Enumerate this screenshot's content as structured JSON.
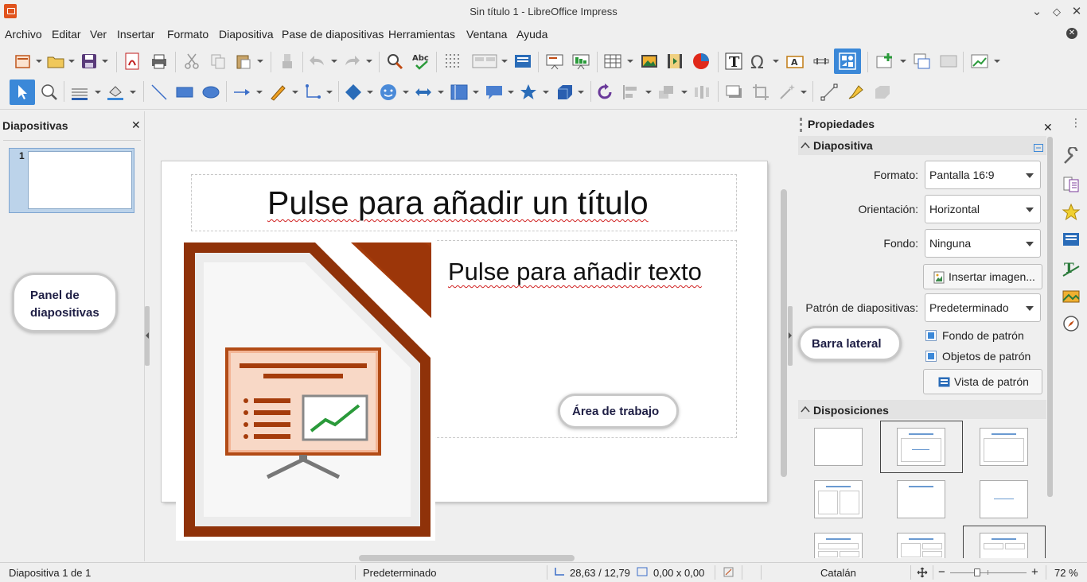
{
  "window": {
    "title": "Sin título 1 - LibreOffice Impress"
  },
  "menu": [
    "Archivo",
    "Editar",
    "Ver",
    "Insertar",
    "Formato",
    "Diapositiva",
    "Pase de diapositivas",
    "Herramientas",
    "Ventana",
    "Ayuda"
  ],
  "slides_panel": {
    "title": "Diapositivas",
    "thumb_number": "1"
  },
  "slide": {
    "title_placeholder": "Pulse para añadir un título",
    "text_placeholder": "Pulse para añadir texto"
  },
  "callouts": {
    "slides_panel": "Panel de diapositivas",
    "sidebar": "Barra lateral",
    "workarea": "Área de trabajo"
  },
  "properties": {
    "title": "Propiedades",
    "section_slide": "Diapositiva",
    "format_label": "Formato:",
    "format_value": "Pantalla 16∶9",
    "orientation_label": "Orientación:",
    "orientation_value": "Horizontal",
    "background_label": "Fondo:",
    "background_value": "Ninguna",
    "insert_image": "Insertar imagen...",
    "master_label": "Patrón de diapositivas:",
    "master_value": "Predeterminado",
    "master_background": "Fondo de patrón",
    "master_objects": "Objetos de patrón",
    "master_view": "Vista de patrón",
    "section_layouts": "Disposiciones"
  },
  "status": {
    "slide_pos": "Diapositiva 1 de 1",
    "master": "Predeterminado",
    "position": "28,63 / 12,79",
    "size": "0,00 x 0,00",
    "language": "Catalán",
    "zoom": "72 %"
  },
  "colors": {
    "accent": "#3b88d8",
    "brand_orange": "#a23d0f"
  }
}
